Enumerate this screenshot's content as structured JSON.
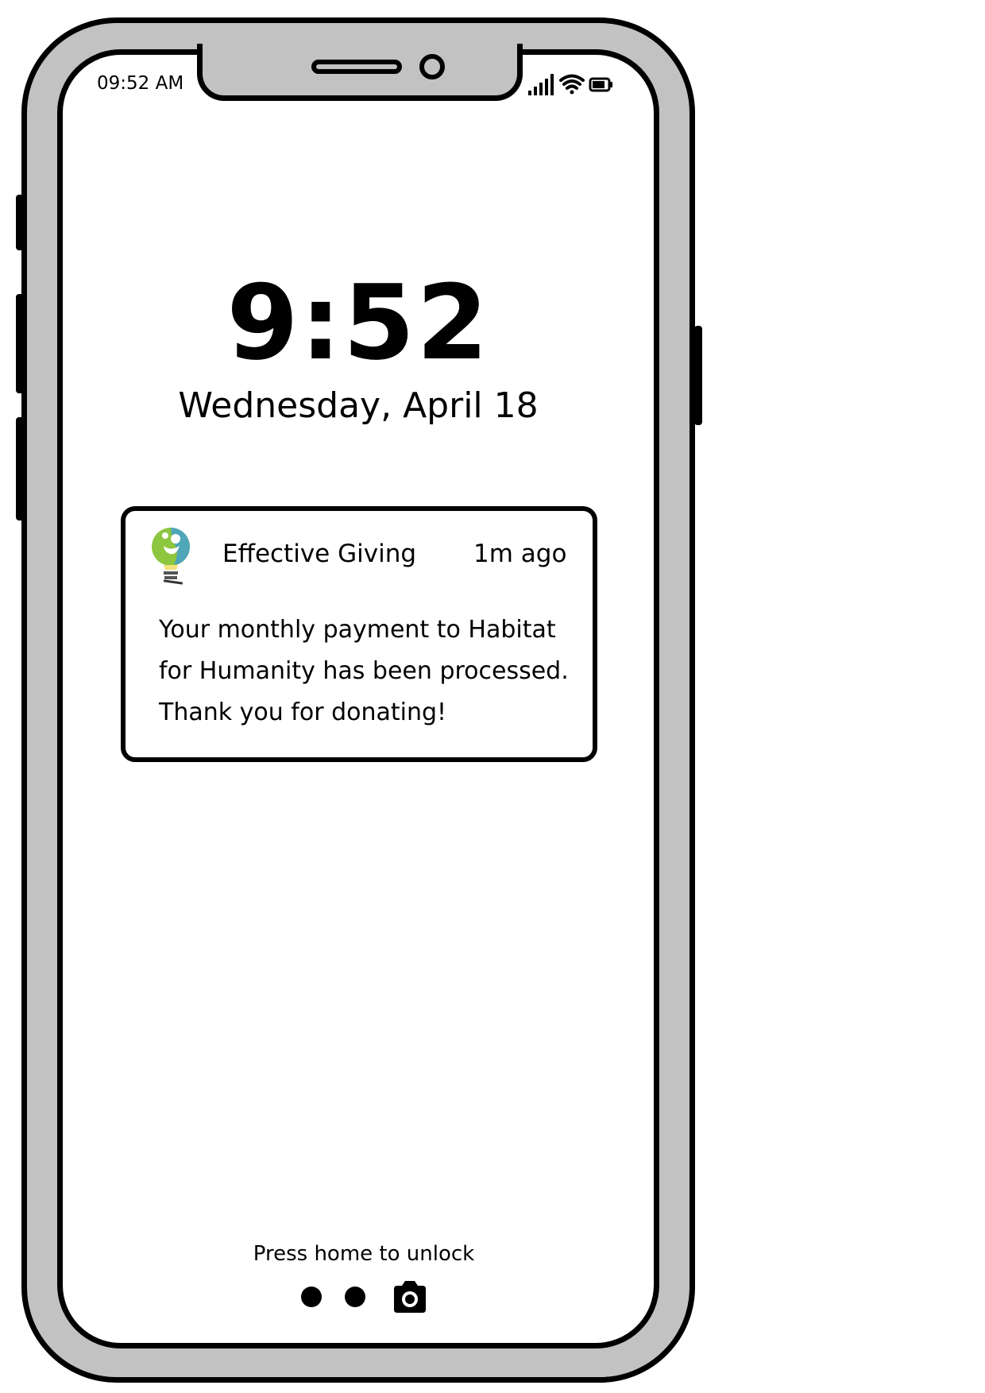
{
  "status_bar": {
    "time": "09:52 AM",
    "icons": [
      "cellular-signal-icon",
      "wifi-icon",
      "battery-icon"
    ]
  },
  "lock_screen": {
    "clock": "9:52",
    "date": "Wednesday, April 18"
  },
  "notification": {
    "app_name": "Effective Giving",
    "time_ago": "1m ago",
    "icon": "lightbulb-globe-icon",
    "message": "Your monthly payment to Habitat for Humanity has been processed. Thank you for donating!",
    "message_lines": [
      "Your monthly payment to Habitat",
      "for Humanity has been processed.",
      "Thank you for donating!"
    ]
  },
  "bottom": {
    "unlock_hint": "Press home to unlock",
    "page_indicators": 2,
    "camera_icon": "camera-icon"
  },
  "colors": {
    "frame": "#c2c2c2",
    "outline": "#000000",
    "screen": "#ffffff",
    "logo_green": "#8dc63f",
    "logo_teal": "#4fa6b8"
  }
}
